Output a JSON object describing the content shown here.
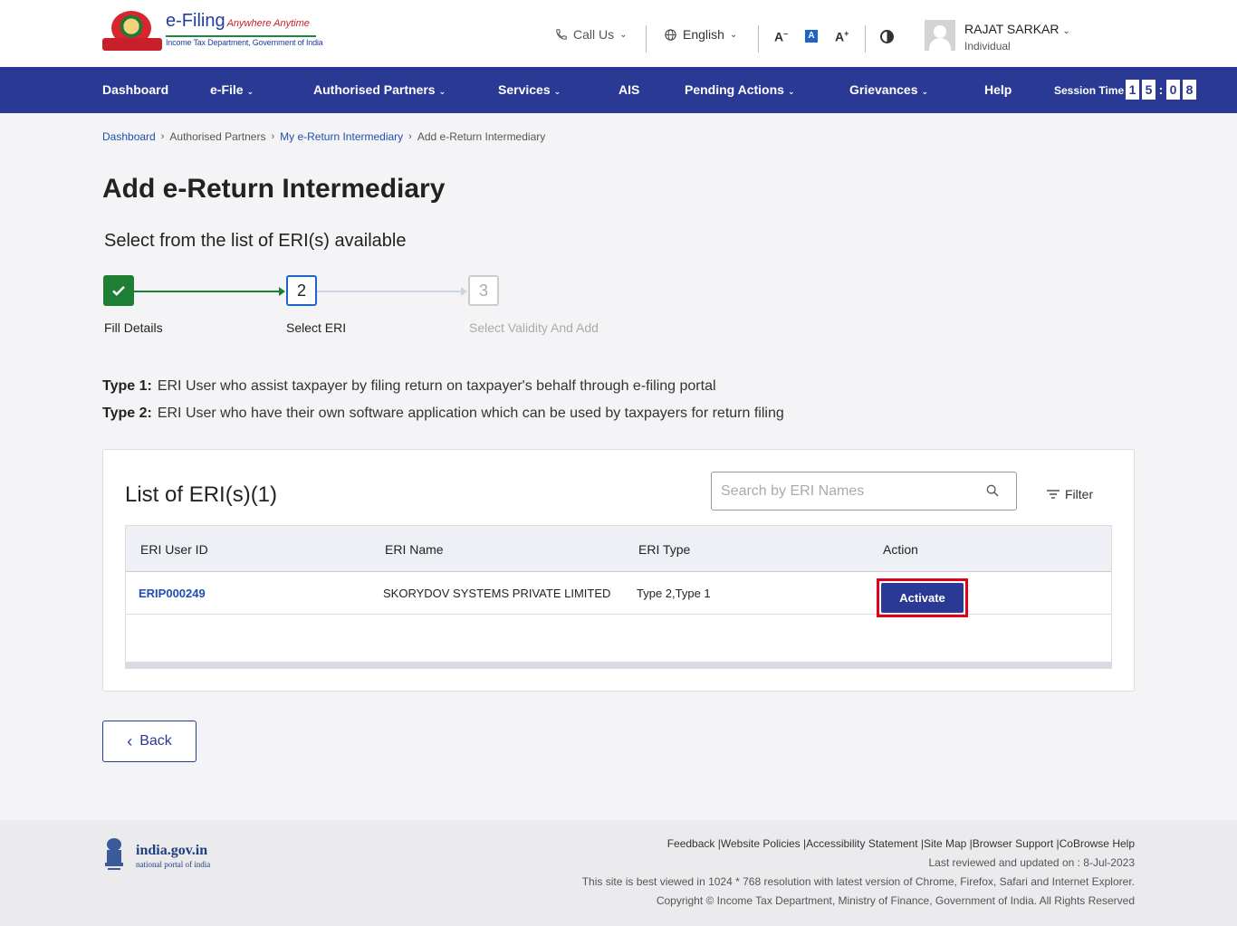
{
  "header": {
    "logo": {
      "title": "e-Filing",
      "tagline": "Anywhere Anytime",
      "subtitle": "Income Tax Department, Government of India"
    },
    "call_us": "Call Us",
    "language": "English",
    "font_decrease": "A",
    "font_reset": "A",
    "font_increase": "A",
    "user": {
      "name": "RAJAT SARKAR",
      "role": "Individual"
    }
  },
  "nav": {
    "items": [
      {
        "label": "Dashboard"
      },
      {
        "label": "e-File"
      },
      {
        "label": "Authorised Partners"
      },
      {
        "label": "Services"
      },
      {
        "label": "AIS"
      },
      {
        "label": "Pending Actions"
      },
      {
        "label": "Grievances"
      },
      {
        "label": "Help"
      }
    ],
    "session_label": "Session Time",
    "session_digits": [
      "1",
      "5",
      "0",
      "8"
    ]
  },
  "breadcrumb": [
    "Dashboard",
    "Authorised Partners",
    "My e-Return Intermediary",
    "Add e-Return Intermediary"
  ],
  "page": {
    "title": "Add e-Return Intermediary",
    "subtitle": "Select from the list of ERI(s) available"
  },
  "stepper": {
    "steps": [
      {
        "number": "1",
        "label": "Fill Details",
        "state": "done"
      },
      {
        "number": "2",
        "label": "Select ERI",
        "state": "active"
      },
      {
        "number": "3",
        "label": "Select Validity And Add",
        "state": "pending"
      }
    ]
  },
  "types": [
    {
      "key": "Type 1:",
      "text": "ERI User who assist taxpayer by filing return on taxpayer's behalf through e-filing portal"
    },
    {
      "key": "Type 2:",
      "text": "ERI User who have their own software application which can be used by taxpayers for return filing"
    }
  ],
  "list": {
    "title": "List of ERI(s)(1)",
    "search_placeholder": "Search by ERI Names",
    "filter_label": "Filter",
    "columns": [
      "ERI User ID",
      "ERI Name",
      "ERI Type",
      "Action"
    ],
    "rows": [
      {
        "id": "ERIP000249",
        "name": "SKORYDOV SYSTEMS PRIVATE LIMITED",
        "type": "Type 2,Type 1",
        "action": "Activate"
      }
    ]
  },
  "back_label": "Back",
  "footer": {
    "logo_title": "india.gov.in",
    "logo_sub": "national portal of india",
    "links": [
      "Feedback",
      "Website Policies",
      "Accessibility Statement",
      "Site Map",
      "Browser Support",
      "CoBrowse Help"
    ],
    "last_reviewed": "Last reviewed and updated on : 8-Jul-2023",
    "best_viewed": "This site is best viewed in 1024 * 768 resolution with latest version of Chrome, Firefox, Safari and Internet Explorer.",
    "copyright": "Copyright © Income Tax Department, Ministry of Finance, Government of India. All Rights Reserved"
  },
  "colors": {
    "nav_bg": "#2a3a94",
    "success": "#1e7e34",
    "link": "#1f4fb0",
    "highlight": "#e0001b"
  }
}
